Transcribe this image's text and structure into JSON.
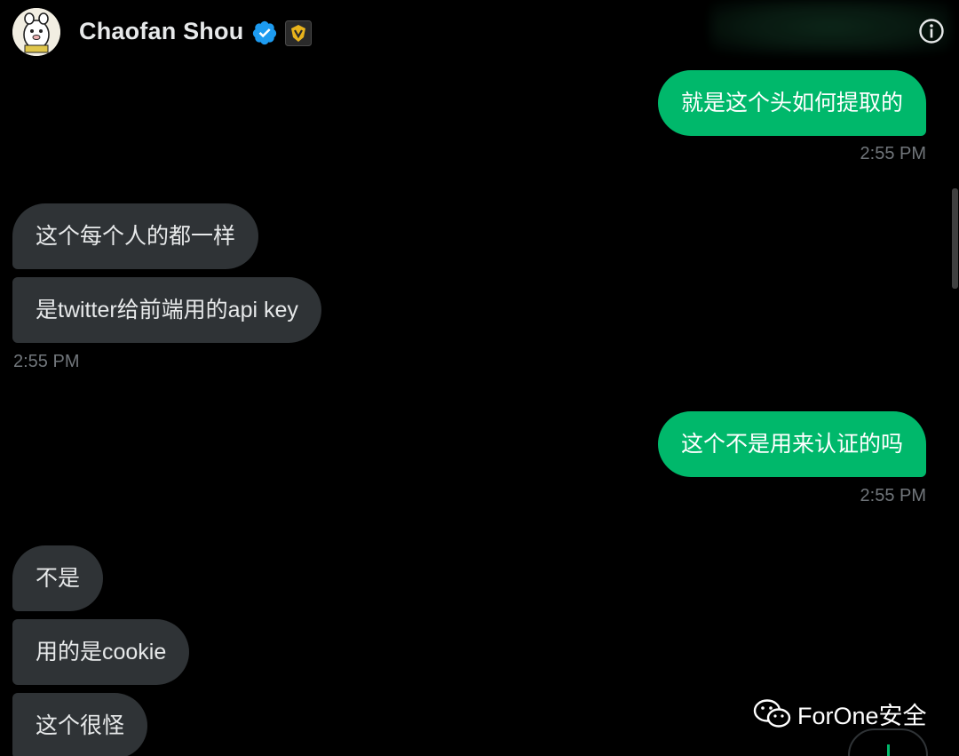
{
  "header": {
    "name": "Chaofan Shou",
    "avatar_icon": "avatar-image",
    "verified_icon": "verified-check-icon",
    "badge_icon": "affiliate-badge-icon",
    "info_icon": "info-icon"
  },
  "messages": [
    {
      "direction": "outgoing",
      "text": "就是这个头如何提取的",
      "time": "2:55 PM"
    },
    {
      "direction": "incoming",
      "text": "这个每个人的都一样"
    },
    {
      "direction": "incoming",
      "text": "是twitter给前端用的api key",
      "time": "2:55 PM"
    },
    {
      "direction": "outgoing",
      "text": "这个不是用来认证的吗",
      "time": "2:55 PM"
    },
    {
      "direction": "incoming",
      "text": "不是"
    },
    {
      "direction": "incoming",
      "text": "用的是cookie"
    },
    {
      "direction": "incoming",
      "text": "这个很怪"
    }
  ],
  "watermark": {
    "icon": "wechat-icon",
    "text": "ForOne安全"
  },
  "colors": {
    "outgoing_bubble": "#00b86b",
    "incoming_bubble": "#2f3336",
    "background": "#000000",
    "timestamp": "#71767b",
    "verified": "#1d9bf0"
  }
}
